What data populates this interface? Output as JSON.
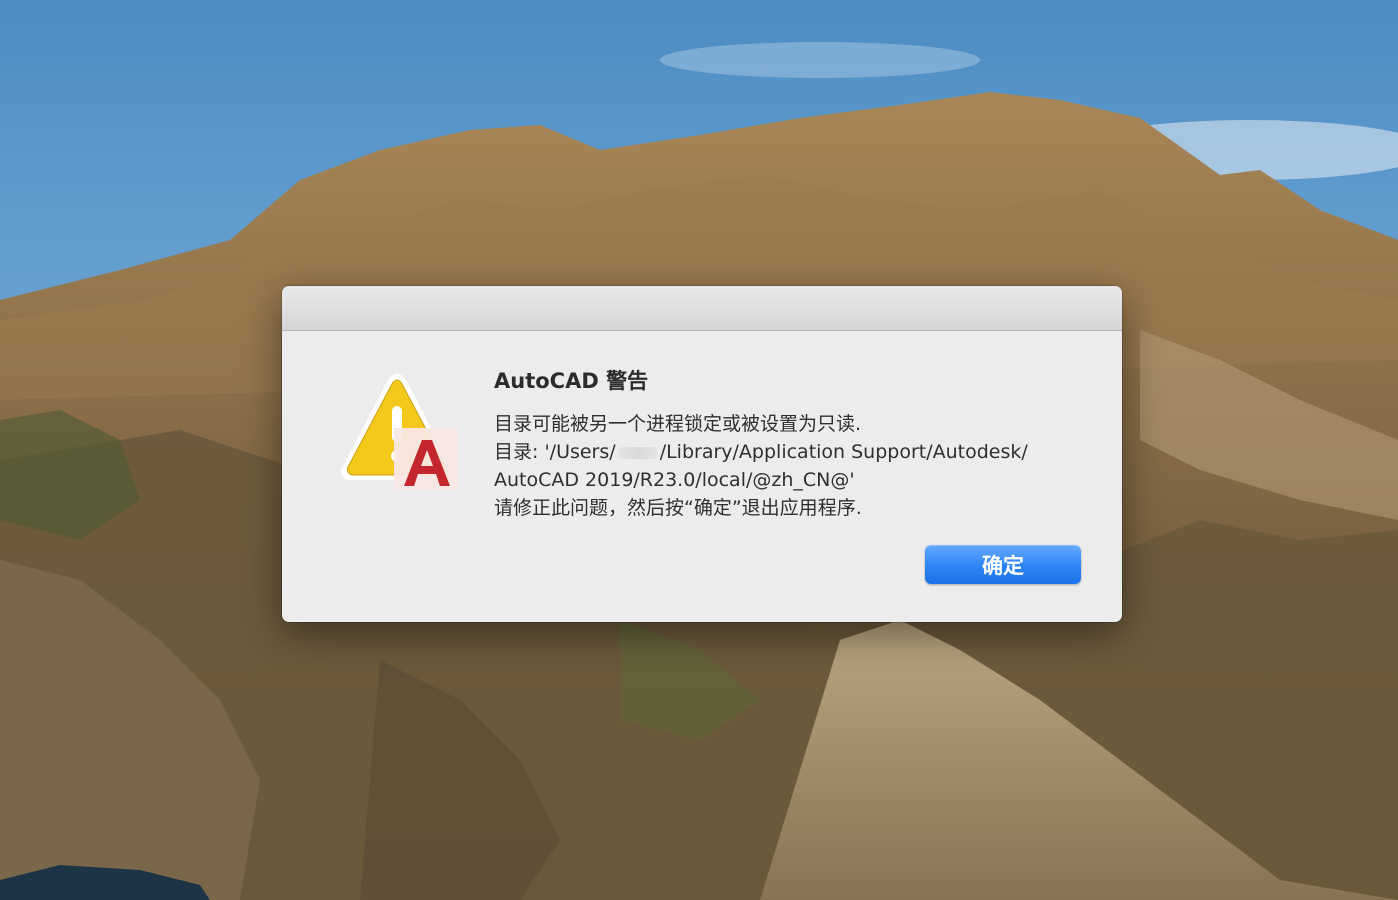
{
  "dialog": {
    "title": "AutoCAD 警告",
    "message": {
      "line1": "目录可能被另一个进程锁定或被设置为只读.",
      "line2_prefix": "目录: '/Users/",
      "line2_suffix": "/Library/Application Support/Autodesk/",
      "line3": "AutoCAD 2019/R23.0/local/@zh_CN@'",
      "line4": "请修正此问题，然后按“确定”退出应用程序."
    },
    "ok_label": "确定",
    "icon": "warning-autocad-icon"
  },
  "colors": {
    "button_blue": "#2d84f5",
    "warning_yellow": "#f3c71a",
    "autocad_red": "#c1272d",
    "dialog_bg": "#ececec"
  }
}
